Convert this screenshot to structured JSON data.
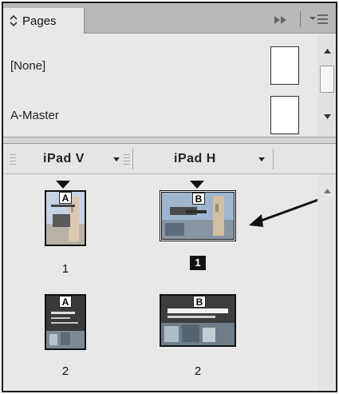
{
  "panel": {
    "tab_label": "Pages",
    "icons": {
      "tab": "updown-icon",
      "forward": "forward-icon",
      "menu": "panel-menu-icon"
    }
  },
  "masters": [
    {
      "label": "[None]"
    },
    {
      "label": "A-Master"
    }
  ],
  "columns": [
    {
      "label": "iPad V"
    },
    {
      "label": "iPad H"
    }
  ],
  "pages": {
    "ipad_v": [
      {
        "prefix": "A",
        "number": "1"
      },
      {
        "prefix": "A",
        "number": "2"
      }
    ],
    "ipad_h": [
      {
        "prefix": "B",
        "number": "1",
        "current": true
      },
      {
        "prefix": "B",
        "number": "2"
      }
    ]
  },
  "colors": {
    "panel_bg": "#e8e8e8",
    "tab_bar": "#b9b9b9",
    "current_page_bg": "#111111"
  }
}
